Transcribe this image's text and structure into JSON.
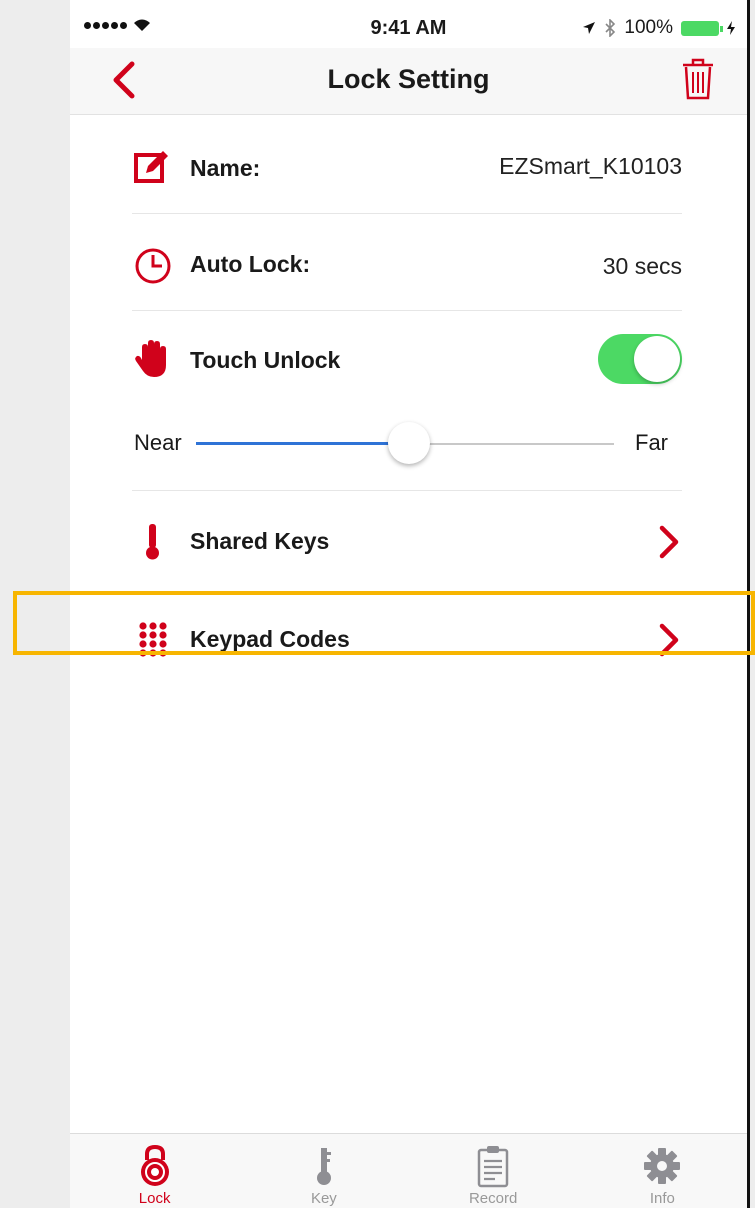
{
  "status_bar": {
    "time": "9:41 AM",
    "battery": "100%"
  },
  "nav": {
    "title": "Lock Setting",
    "back_icon": "chevron-left-icon",
    "trash_icon": "trash-icon"
  },
  "settings": {
    "name": {
      "label": "Name:",
      "value": "EZSmart_K10103"
    },
    "auto_lock": {
      "label": "Auto Lock:",
      "value": "30 secs"
    },
    "touch_unlock": {
      "label": "Touch Unlock",
      "enabled": true
    },
    "range": {
      "near_label": "Near",
      "far_label": "Far",
      "level": 0.51
    },
    "shared_keys": {
      "label": "Shared Keys"
    },
    "keypad_codes": {
      "label": "Keypad Codes"
    }
  },
  "tabs": [
    {
      "label": "Lock",
      "icon": "lock-icon",
      "active": true
    },
    {
      "label": "Key",
      "icon": "key-icon",
      "active": false
    },
    {
      "label": "Record",
      "icon": "clipboard-icon",
      "active": false
    },
    {
      "label": "Info",
      "icon": "gear-icon",
      "active": false
    }
  ],
  "colors": {
    "accent": "#d0021b",
    "toggle_on": "#4cd964",
    "slider_fill": "#2f73d6",
    "highlight": "#f7b500"
  }
}
